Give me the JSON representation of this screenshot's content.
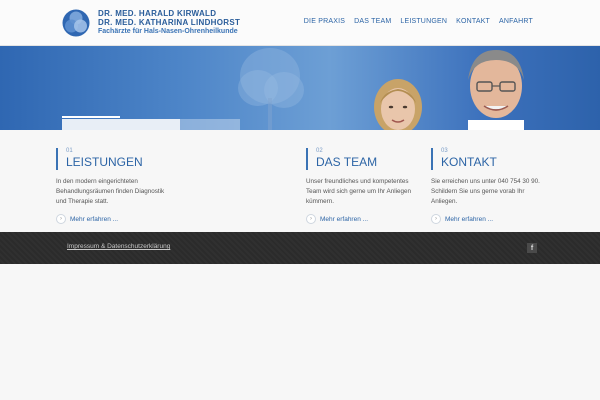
{
  "header": {
    "logo": {
      "line1": "Dr. med. Harald Kirwald",
      "line2": "Dr. med. Katharina Lindhorst",
      "line3": "Fachärzte für Hals-Nasen-Ohrenheilkunde"
    },
    "nav": [
      {
        "label": "DIE PRAXIS"
      },
      {
        "label": "DAS TEAM"
      },
      {
        "label": "LEISTUNGEN"
      },
      {
        "label": "KONTAKT"
      },
      {
        "label": "ANFAHRT"
      }
    ]
  },
  "columns": [
    {
      "num": "01",
      "title": "LEISTUNGEN",
      "text": "In den modern eingerichteten Behandlungsräumen finden Diagnostik und Therapie statt.",
      "more": "Mehr erfahren ..."
    },
    {
      "num": "02",
      "title": "DAS TEAM",
      "text": "Unser freundliches und kompetentes Team wird sich gerne um Ihr Anliegen kümmern.",
      "more": "Mehr erfahren ..."
    },
    {
      "num": "03",
      "title": "KONTAKT",
      "text": "Sie erreichen uns unter 040 754 30 90. Schildern Sie uns gerne vorab Ihr Anliegen.",
      "more": "Mehr erfahren ..."
    }
  ],
  "footer": {
    "link": "Impressum & Datenschutzerklärung",
    "social": "f"
  },
  "colors": {
    "brand_blue": "#2d65a6",
    "footer_bg": "#2b2b2b",
    "page_bg": "#f7f7f7"
  }
}
